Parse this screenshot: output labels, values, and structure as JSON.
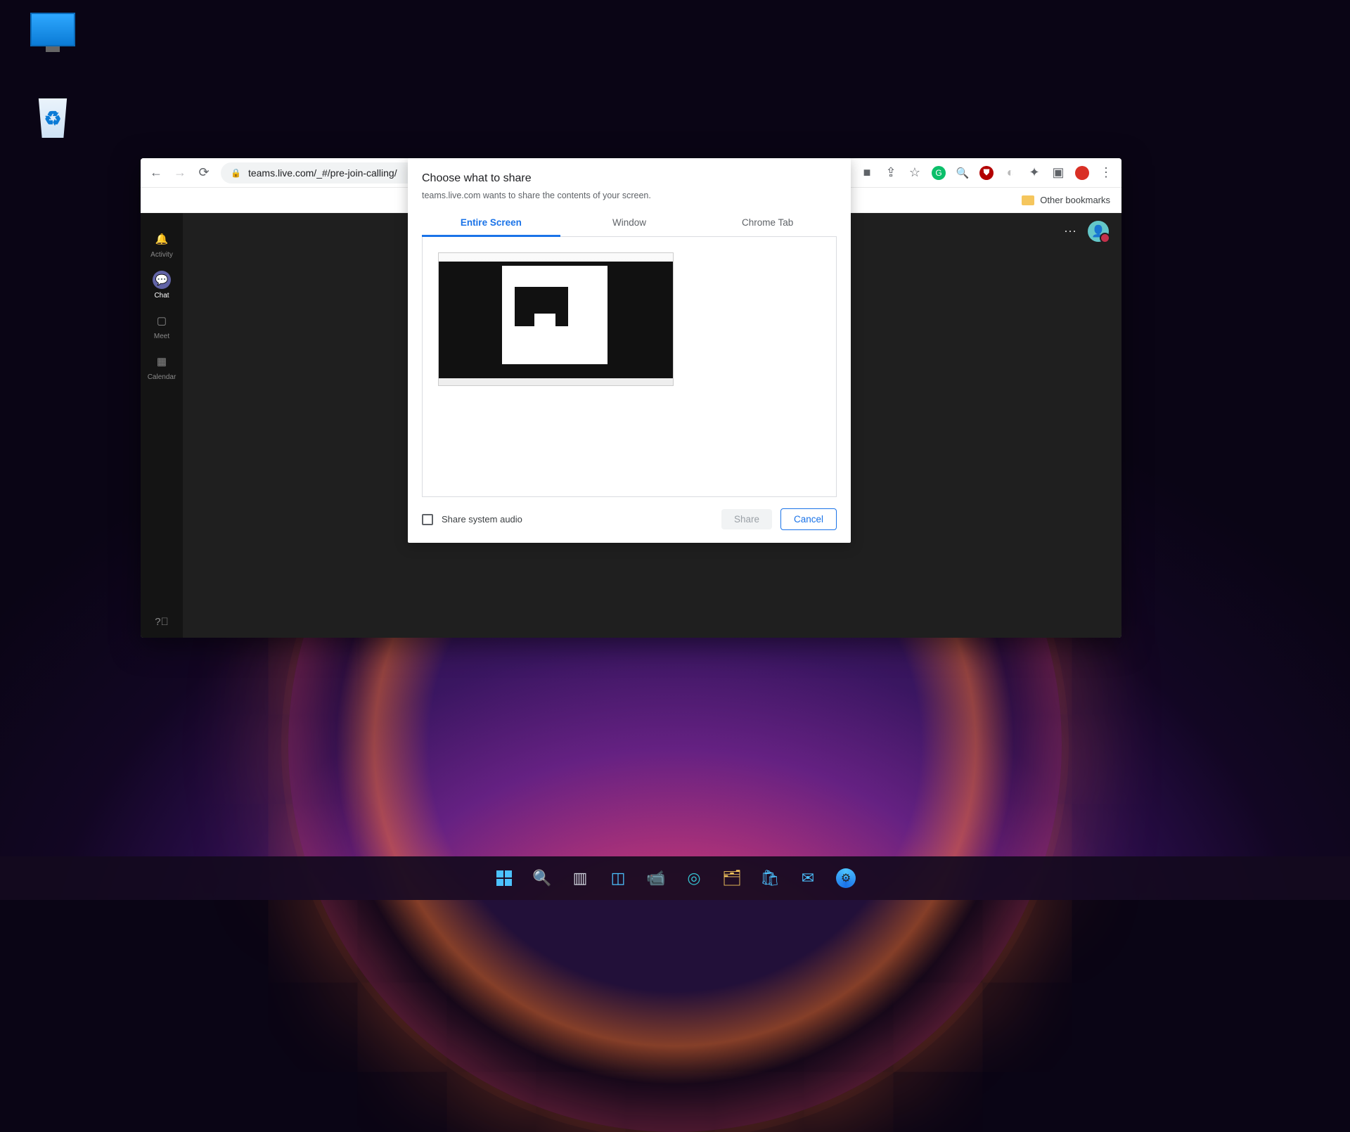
{
  "browser": {
    "url": "teams.live.com/_#/pre-join-calling/",
    "bookmarks_bar": {
      "other": "Other bookmarks"
    }
  },
  "teams": {
    "rail": {
      "activity": "Activity",
      "chat": "Chat",
      "meet": "Meet",
      "calendar": "Calendar"
    }
  },
  "share_dialog": {
    "title": "Choose what to share",
    "subtitle": "teams.live.com wants to share the contents of your screen.",
    "tabs": {
      "entire": "Entire Screen",
      "window": "Window",
      "tab": "Chrome Tab"
    },
    "audio_label": "Share system audio",
    "share": "Share",
    "cancel": "Cancel"
  }
}
